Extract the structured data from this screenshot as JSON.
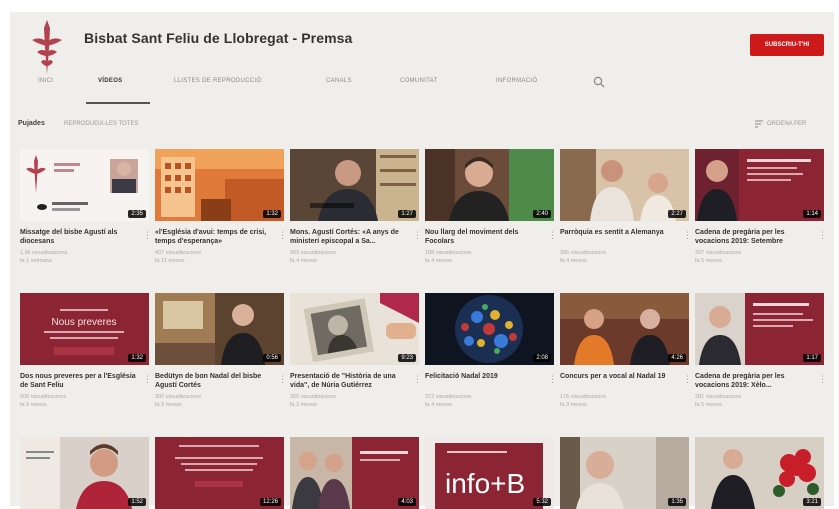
{
  "channel": {
    "title": "Bisbat Sant Feliu de Llobregat - Premsa",
    "subscribe_label": "SUBSCRIU-T'HI"
  },
  "tabs": [
    {
      "label": "INICI"
    },
    {
      "label": "VÍDEOS",
      "active": true
    },
    {
      "label": "LLISTES DE REPRODUCCIÓ"
    },
    {
      "label": "CANALS"
    },
    {
      "label": "COMUNITAT"
    },
    {
      "label": "INFORMACIÓ"
    }
  ],
  "playlist": {
    "title": "Pujades",
    "subtitle": "REPRODUEIX-LES TOTES",
    "sort_label": "ORDENA PER"
  },
  "videos": [
    {
      "title": "Missatge del bisbe Agustí als diocesans",
      "views": "1.9k visualitzacions",
      "age": "fa 1 setmana",
      "duration": "2:35"
    },
    {
      "title": "«l'Església d'avui: temps de crisi, temps d'esperança»",
      "views": "437 visualitzacions",
      "age": "fa 11 mesos",
      "duration": "1:32"
    },
    {
      "title": "Mons. Agustí Cortés: «A anys de ministeri episcopal a Sa...",
      "views": "999 visualitzacions",
      "age": "fa 4 mesos",
      "duration": "1:27"
    },
    {
      "title": "Nou llarg del moviment dels Focolars",
      "views": "188 visualitzacions",
      "age": "fa 4 mesos",
      "duration": "2:40"
    },
    {
      "title": "Parròquia es sentit a Alemanya",
      "views": "395 visualitzacions",
      "age": "fa 4 mesos",
      "duration": "2:27"
    },
    {
      "title": "Cadena de pregària per les vocacions 2019: Setembre",
      "views": "397 visualitzacions",
      "age": "fa 5 mesos",
      "duration": "1:14"
    },
    {
      "title": "Dos nous preveres per a l'Església de Sant Feliu",
      "views": "506 visualitzacions",
      "age": "fa 5 mesos",
      "duration": "1:32"
    },
    {
      "title": "Bedütyn de bon Nadal del bisbe Agustí Cortés",
      "views": "300 visualitzacions",
      "age": "fa 2 mesos",
      "duration": "0:56"
    },
    {
      "title": "Presentació de \"Història de una vida\", de Núria Gutiérrez",
      "views": "260 visualitzacions",
      "age": "fa 2 mesos",
      "duration": "9:23"
    },
    {
      "title": "Felicitació Nadal 2019",
      "views": "372 visualitzacions",
      "age": "fa 4 mesos",
      "duration": "2:08"
    },
    {
      "title": "Concurs per a vocal al Nadal 19",
      "views": "176 visualitzacions",
      "age": "fa 3 mesos",
      "duration": "4:26"
    },
    {
      "title": "Cadena de pregària per les vocacions 2019: Xèlo...",
      "views": "281 visualitzacions",
      "age": "fa 5 mesos",
      "duration": "1:17"
    },
    {
      "duration": "1:52"
    },
    {
      "duration": "12:26"
    },
    {
      "duration": "4:03"
    },
    {
      "duration": "5:32"
    },
    {
      "duration": "1:35"
    },
    {
      "duration": "3:21"
    }
  ],
  "thumb_text": {
    "t7_heading": "Nous preveres",
    "t13_heading": "info+B"
  },
  "colors": {
    "brand_red": "#cc1a1a",
    "maroon": "#8b2433",
    "background": "#efeeeb"
  }
}
